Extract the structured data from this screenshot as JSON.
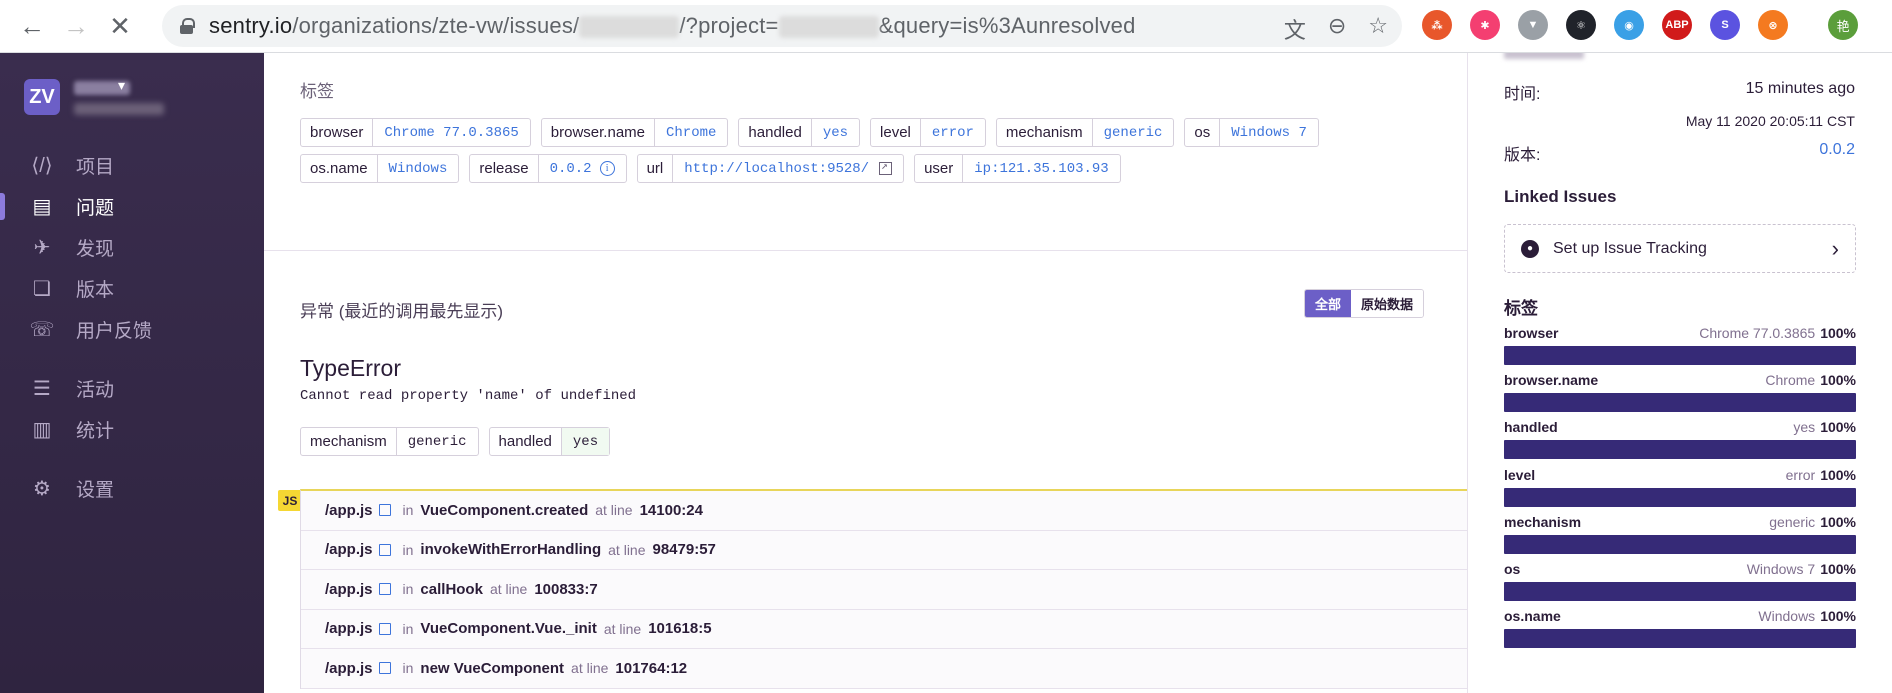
{
  "browser": {
    "url_host": "sentry.io",
    "url_path_1": "/organizations/zte-vw/issues/",
    "url_path_2": "/?project=",
    "url_path_3": "&query=is%3Aunresolved"
  },
  "extensions": [
    {
      "name": "graph-ext-icon",
      "color": "#e8572b",
      "label": "⁂"
    },
    {
      "name": "pinwheel-ext-icon",
      "color": "#f43f71",
      "label": "✱"
    },
    {
      "name": "vue-ext-icon",
      "color": "#9aa0a6",
      "label": "▼"
    },
    {
      "name": "react-ext-icon",
      "color": "#20232a",
      "label": "⚛"
    },
    {
      "name": "colorful-ext-icon",
      "color": "#3aa0e6",
      "label": "◉"
    },
    {
      "name": "abp-ext-icon",
      "color": "#d11a1a",
      "label": "ABP"
    },
    {
      "name": "s-ext-icon",
      "color": "#5b53e0",
      "label": "S"
    },
    {
      "name": "orange-ext-icon",
      "color": "#f47a20",
      "label": "⊗"
    }
  ],
  "profile_initial": "艳",
  "sidebar": {
    "org_initials": "ZV",
    "items": [
      {
        "label": "项目",
        "icon": "projects-icon",
        "glyph": "⟨/⟩",
        "active": false
      },
      {
        "label": "问题",
        "icon": "issues-icon",
        "glyph": "▤",
        "active": true
      },
      {
        "label": "发现",
        "icon": "discover-icon",
        "glyph": "✈",
        "active": false
      },
      {
        "label": "版本",
        "icon": "releases-icon",
        "glyph": "❏",
        "active": false
      },
      {
        "label": "用户反馈",
        "icon": "feedback-icon",
        "glyph": "☏",
        "active": false
      },
      {
        "label": "活动",
        "icon": "activity-icon",
        "glyph": "☰",
        "active": false
      },
      {
        "label": "统计",
        "icon": "stats-icon",
        "glyph": "▥",
        "active": false
      },
      {
        "label": "设置",
        "icon": "settings-icon",
        "glyph": "⚙",
        "active": false
      }
    ]
  },
  "main": {
    "tags_title": "标签",
    "tags_row1": [
      {
        "key": "browser",
        "value": "Chrome 77.0.3865"
      },
      {
        "key": "browser.name",
        "value": "Chrome"
      },
      {
        "key": "handled",
        "value": "yes"
      },
      {
        "key": "level",
        "value": "error"
      },
      {
        "key": "mechanism",
        "value": "generic"
      },
      {
        "key": "os",
        "value": "Windows 7"
      }
    ],
    "tags_row2": [
      {
        "key": "os.name",
        "value": "Windows"
      },
      {
        "key": "release",
        "value": "0.0.2"
      },
      {
        "key": "url",
        "value": "http://localhost:9528/"
      },
      {
        "key": "user",
        "value": "ip:121.35.103.93"
      }
    ],
    "exception_title": "异常 (最近的调用最先显示)",
    "toggle_all": "全部",
    "toggle_raw": "原始数据",
    "error_type": "TypeError",
    "error_message": "Cannot read property 'name' of undefined",
    "mechanism": [
      {
        "key": "mechanism",
        "value": "generic"
      },
      {
        "key": "handled",
        "value": "yes"
      }
    ],
    "platform_badge": "JS",
    "in_word": "in",
    "at_line_word": "at line",
    "frames": [
      {
        "file": "/app.js",
        "fn": "VueComponent.created",
        "line": "14100:24"
      },
      {
        "file": "/app.js",
        "fn": "invokeWithErrorHandling",
        "line": "98479:57"
      },
      {
        "file": "/app.js",
        "fn": "callHook",
        "line": "100833:7"
      },
      {
        "file": "/app.js",
        "fn": "VueComponent.Vue._init",
        "line": "101618:5"
      },
      {
        "file": "/app.js",
        "fn": "new VueComponent",
        "line": "101764:12"
      }
    ]
  },
  "right": {
    "time_label": "时间:",
    "time_value": "15 minutes ago",
    "time_exact": "May 11 2020 20:05:11 CST",
    "version_label": "版本:",
    "version_value": "0.0.2",
    "linked_title": "Linked Issues",
    "tracking_label": "Set up Issue Tracking",
    "tags_title": "标签",
    "tag_stats": [
      {
        "name": "browser",
        "value": "Chrome 77.0.3865",
        "pct": "100%"
      },
      {
        "name": "browser.name",
        "value": "Chrome",
        "pct": "100%"
      },
      {
        "name": "handled",
        "value": "yes",
        "pct": "100%"
      },
      {
        "name": "level",
        "value": "error",
        "pct": "100%"
      },
      {
        "name": "mechanism",
        "value": "generic",
        "pct": "100%"
      },
      {
        "name": "os",
        "value": "Windows 7",
        "pct": "100%"
      },
      {
        "name": "os.name",
        "value": "Windows",
        "pct": "100%"
      }
    ]
  }
}
